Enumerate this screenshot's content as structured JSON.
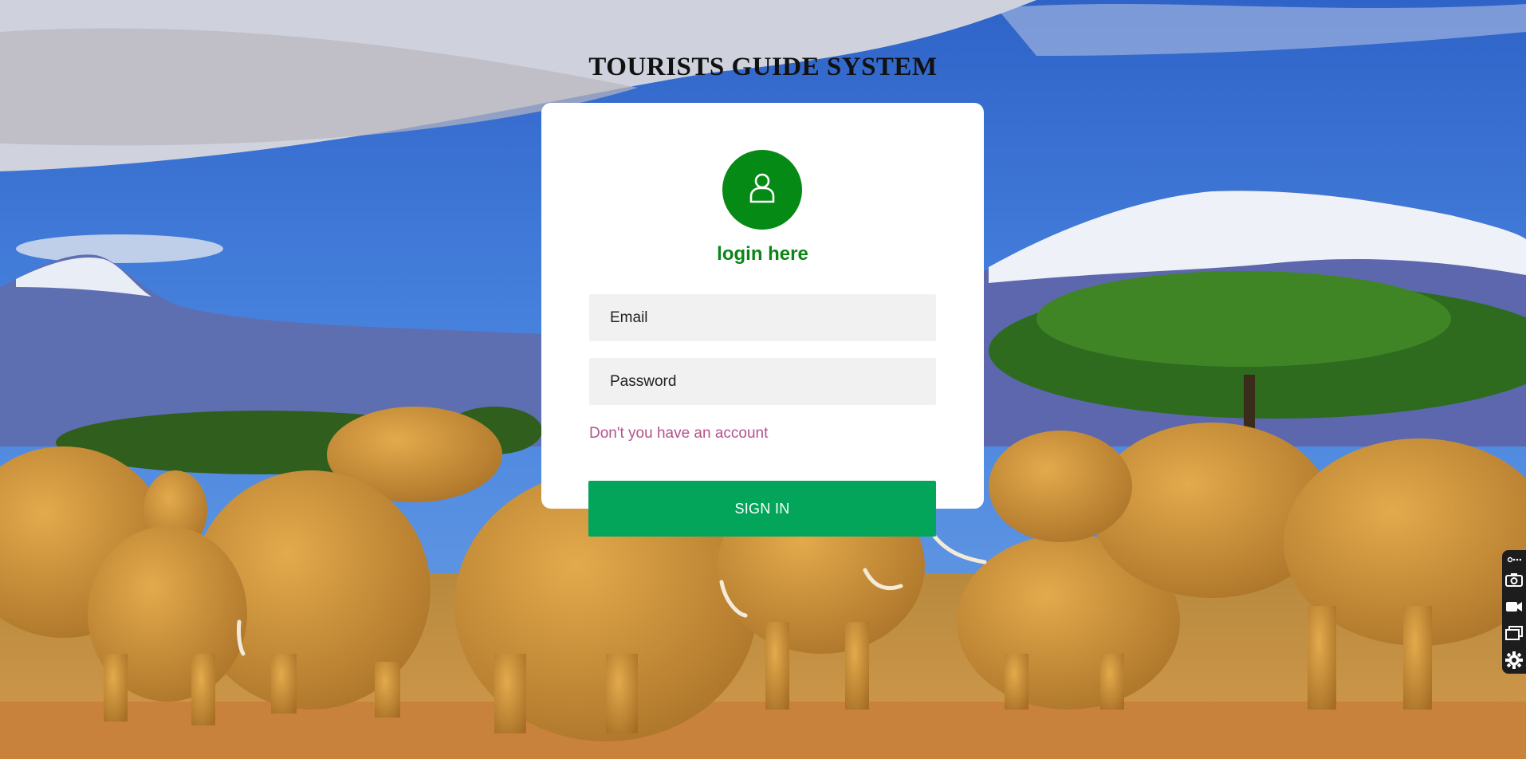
{
  "page": {
    "title": "TOURISTS GUIDE SYSTEM"
  },
  "login_card": {
    "avatar_icon": "user-icon",
    "heading": "login here",
    "email_placeholder": "Email",
    "password_placeholder": "Password",
    "signup_link": "Don't you have an account",
    "signin_button": "SIGN IN"
  },
  "background": {
    "description_icon": "landscape-photo"
  },
  "side_toolbar": {
    "items": [
      "link-icon",
      "camera-icon",
      "video-icon",
      "windows-icon",
      "gear-icon"
    ]
  },
  "colors": {
    "accent_green": "#058a15",
    "button_green": "#02a55a",
    "link_pink": "#b4528c"
  }
}
